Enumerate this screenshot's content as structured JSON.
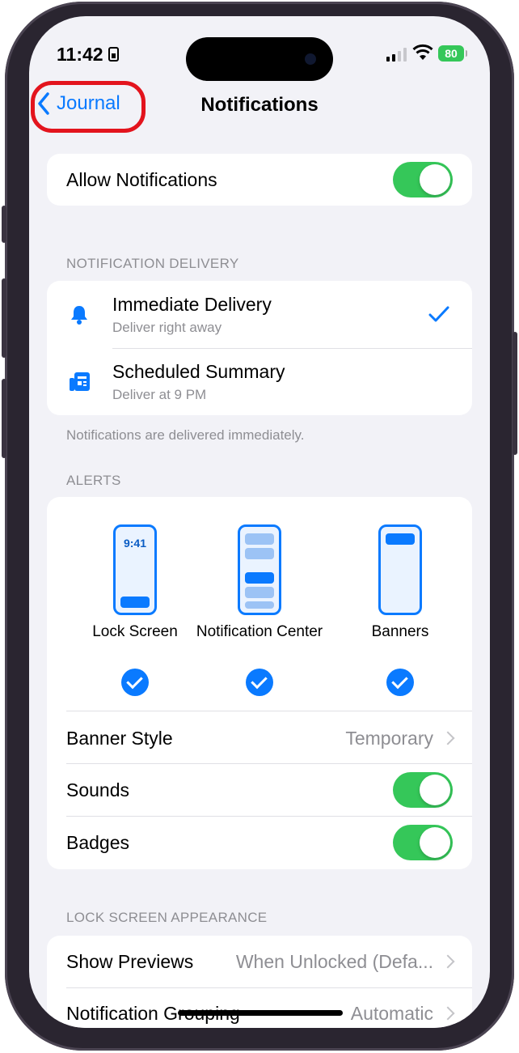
{
  "status_bar": {
    "time": "11:42",
    "battery": "80"
  },
  "nav": {
    "back_label": "Journal",
    "title": "Notifications"
  },
  "allow": {
    "label": "Allow Notifications",
    "on": true
  },
  "delivery": {
    "header": "NOTIFICATION DELIVERY",
    "options": [
      {
        "title": "Immediate Delivery",
        "subtitle": "Deliver right away",
        "icon": "bell-icon",
        "selected": true
      },
      {
        "title": "Scheduled Summary",
        "subtitle": "Deliver at 9 PM",
        "icon": "summary-icon",
        "selected": false
      }
    ],
    "footer": "Notifications are delivered immediately."
  },
  "alerts": {
    "header": "ALERTS",
    "items": [
      {
        "label": "Lock Screen",
        "preview_time": "9:41",
        "checked": true
      },
      {
        "label": "Notification Center",
        "checked": true
      },
      {
        "label": "Banners",
        "checked": true
      }
    ],
    "banner_style": {
      "label": "Banner Style",
      "value": "Temporary"
    },
    "sounds": {
      "label": "Sounds",
      "on": true
    },
    "badges": {
      "label": "Badges",
      "on": true
    }
  },
  "lock_screen": {
    "header": "LOCK SCREEN APPEARANCE",
    "show_previews": {
      "label": "Show Previews",
      "value": "When Unlocked (Defa..."
    },
    "grouping": {
      "label": "Notification Grouping",
      "value": "Automatic"
    }
  },
  "colors": {
    "accent": "#0a7aff",
    "toggle_on": "#35c759",
    "highlight": "#e3141d"
  }
}
